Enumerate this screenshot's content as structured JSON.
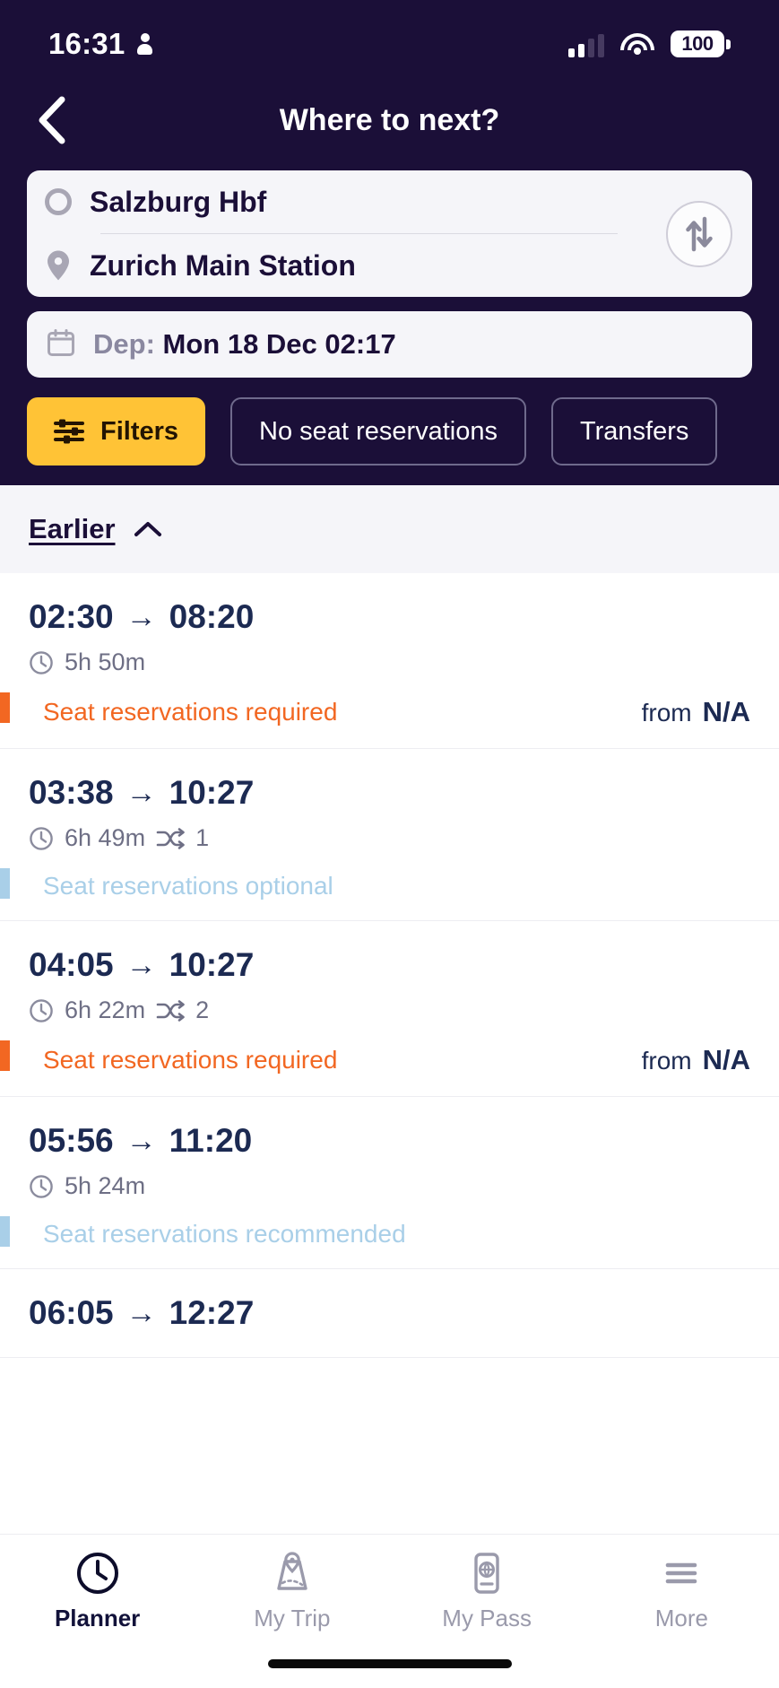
{
  "status_bar": {
    "time": "16:31",
    "battery_level": "100",
    "icons": [
      "person-icon",
      "cellular-signal-icon",
      "wifi-icon",
      "battery-icon"
    ]
  },
  "header": {
    "title": "Where to next?",
    "back_icon": "chevron-left-icon",
    "background_color": "#1b0f38"
  },
  "search": {
    "origin": {
      "label": "Salzburg Hbf",
      "icon": "circle-outline-icon"
    },
    "destination": {
      "label": "Zurich Main Station",
      "icon": "map-pin-icon"
    },
    "swap_icon": "swap-vertical-arrows-icon",
    "date": {
      "prefix": "Dep:",
      "value": "Mon 18 Dec 02:17",
      "icon": "calendar-icon"
    }
  },
  "chips": [
    {
      "label": "Filters",
      "icon": "sliders-icon",
      "style": "primary",
      "color": "#ffc336"
    },
    {
      "label": "No seat reservations",
      "style": "outline"
    },
    {
      "label": "Transfers",
      "style": "outline"
    }
  ],
  "earlier": {
    "label": "Earlier",
    "icon": "chevron-up-icon"
  },
  "colors": {
    "required": "#f26722",
    "optional": "#a9cfe8",
    "recommended": "#a9cfe8",
    "accent": "#ffc336",
    "header_bg": "#1b0f38",
    "time_text": "#1c2a52"
  },
  "trips": [
    {
      "depart": "02:30",
      "arrow": "→",
      "arrive": "08:20",
      "duration": "5h 50m",
      "clock_icon": "clock-icon",
      "transfers": null,
      "transfer_icon": "transfer-icon",
      "status": "Seat reservations required",
      "status_type": "required",
      "price_from": "from",
      "price": "N/A"
    },
    {
      "depart": "03:38",
      "arrow": "→",
      "arrive": "10:27",
      "duration": "6h 49m",
      "clock_icon": "clock-icon",
      "transfers": "1",
      "transfer_icon": "transfer-icon",
      "status": "Seat reservations optional",
      "status_type": "optional",
      "price_from": "",
      "price": ""
    },
    {
      "depart": "04:05",
      "arrow": "→",
      "arrive": "10:27",
      "duration": "6h 22m",
      "clock_icon": "clock-icon",
      "transfers": "2",
      "transfer_icon": "transfer-icon",
      "status": "Seat reservations required",
      "status_type": "required",
      "price_from": "from",
      "price": "N/A"
    },
    {
      "depart": "05:56",
      "arrow": "→",
      "arrive": "11:20",
      "duration": "5h 24m",
      "clock_icon": "clock-icon",
      "transfers": null,
      "transfer_icon": "transfer-icon",
      "status": "Seat reservations recommended",
      "status_type": "recommended",
      "price_from": "",
      "price": ""
    },
    {
      "depart": "06:05",
      "arrow": "→",
      "arrive": "12:27",
      "duration": "",
      "clock_icon": "clock-icon",
      "transfers": null,
      "transfer_icon": "transfer-icon",
      "status": "",
      "status_type": "",
      "price_from": "",
      "price": ""
    }
  ],
  "bottom_nav": [
    {
      "label": "Planner",
      "icon": "clock-icon",
      "active": true
    },
    {
      "label": "My Trip",
      "icon": "map-location-icon",
      "active": false
    },
    {
      "label": "My Pass",
      "icon": "phone-globe-icon",
      "active": false
    },
    {
      "label": "More",
      "icon": "hamburger-menu-icon",
      "active": false
    }
  ]
}
